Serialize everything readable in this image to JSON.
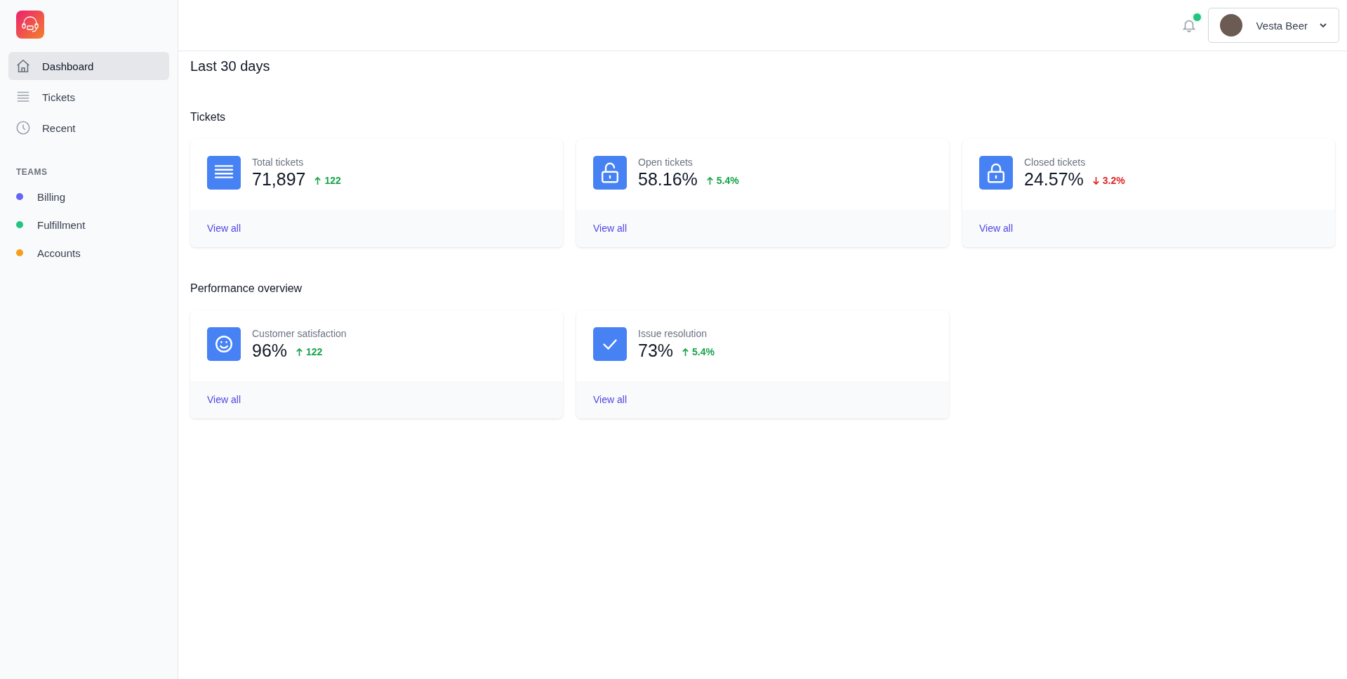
{
  "sidebar": {
    "nav": [
      {
        "label": "Dashboard",
        "kind": "home",
        "selected": true
      },
      {
        "label": "Tickets",
        "kind": "lines",
        "selected": false
      },
      {
        "label": "Recent",
        "kind": "clock",
        "selected": false
      }
    ],
    "teams_heading": "TEAMS",
    "teams": [
      {
        "label": "Billing",
        "color": "#6366f1"
      },
      {
        "label": "Fulfillment",
        "color": "#22c383"
      },
      {
        "label": "Accounts",
        "color": "#f59e1b"
      }
    ]
  },
  "header": {
    "notifications_unread": true,
    "user_name": "Vesta Beer"
  },
  "period": "Last 30 days",
  "sections": [
    {
      "title": "Tickets",
      "cards": [
        {
          "kind": "lines",
          "label": "Total tickets",
          "value": "71,897",
          "increase": true,
          "change": "122",
          "link": "View all"
        },
        {
          "kind": "unlock",
          "label": "Open tickets",
          "value": "58.16%",
          "increase": true,
          "change": "5.4%",
          "link": "View all"
        },
        {
          "kind": "lock",
          "label": "Closed tickets",
          "value": "24.57%",
          "increase": false,
          "change": "3.2%",
          "link": "View all"
        }
      ]
    },
    {
      "title": "Performance overview",
      "cards": [
        {
          "kind": "smile",
          "label": "Customer satisfaction",
          "value": "96%",
          "increase": true,
          "change": "122",
          "link": "View all"
        },
        {
          "kind": "check",
          "label": "Issue resolution",
          "value": "73%",
          "increase": true,
          "change": "5.4%",
          "link": "View all"
        }
      ]
    }
  ]
}
